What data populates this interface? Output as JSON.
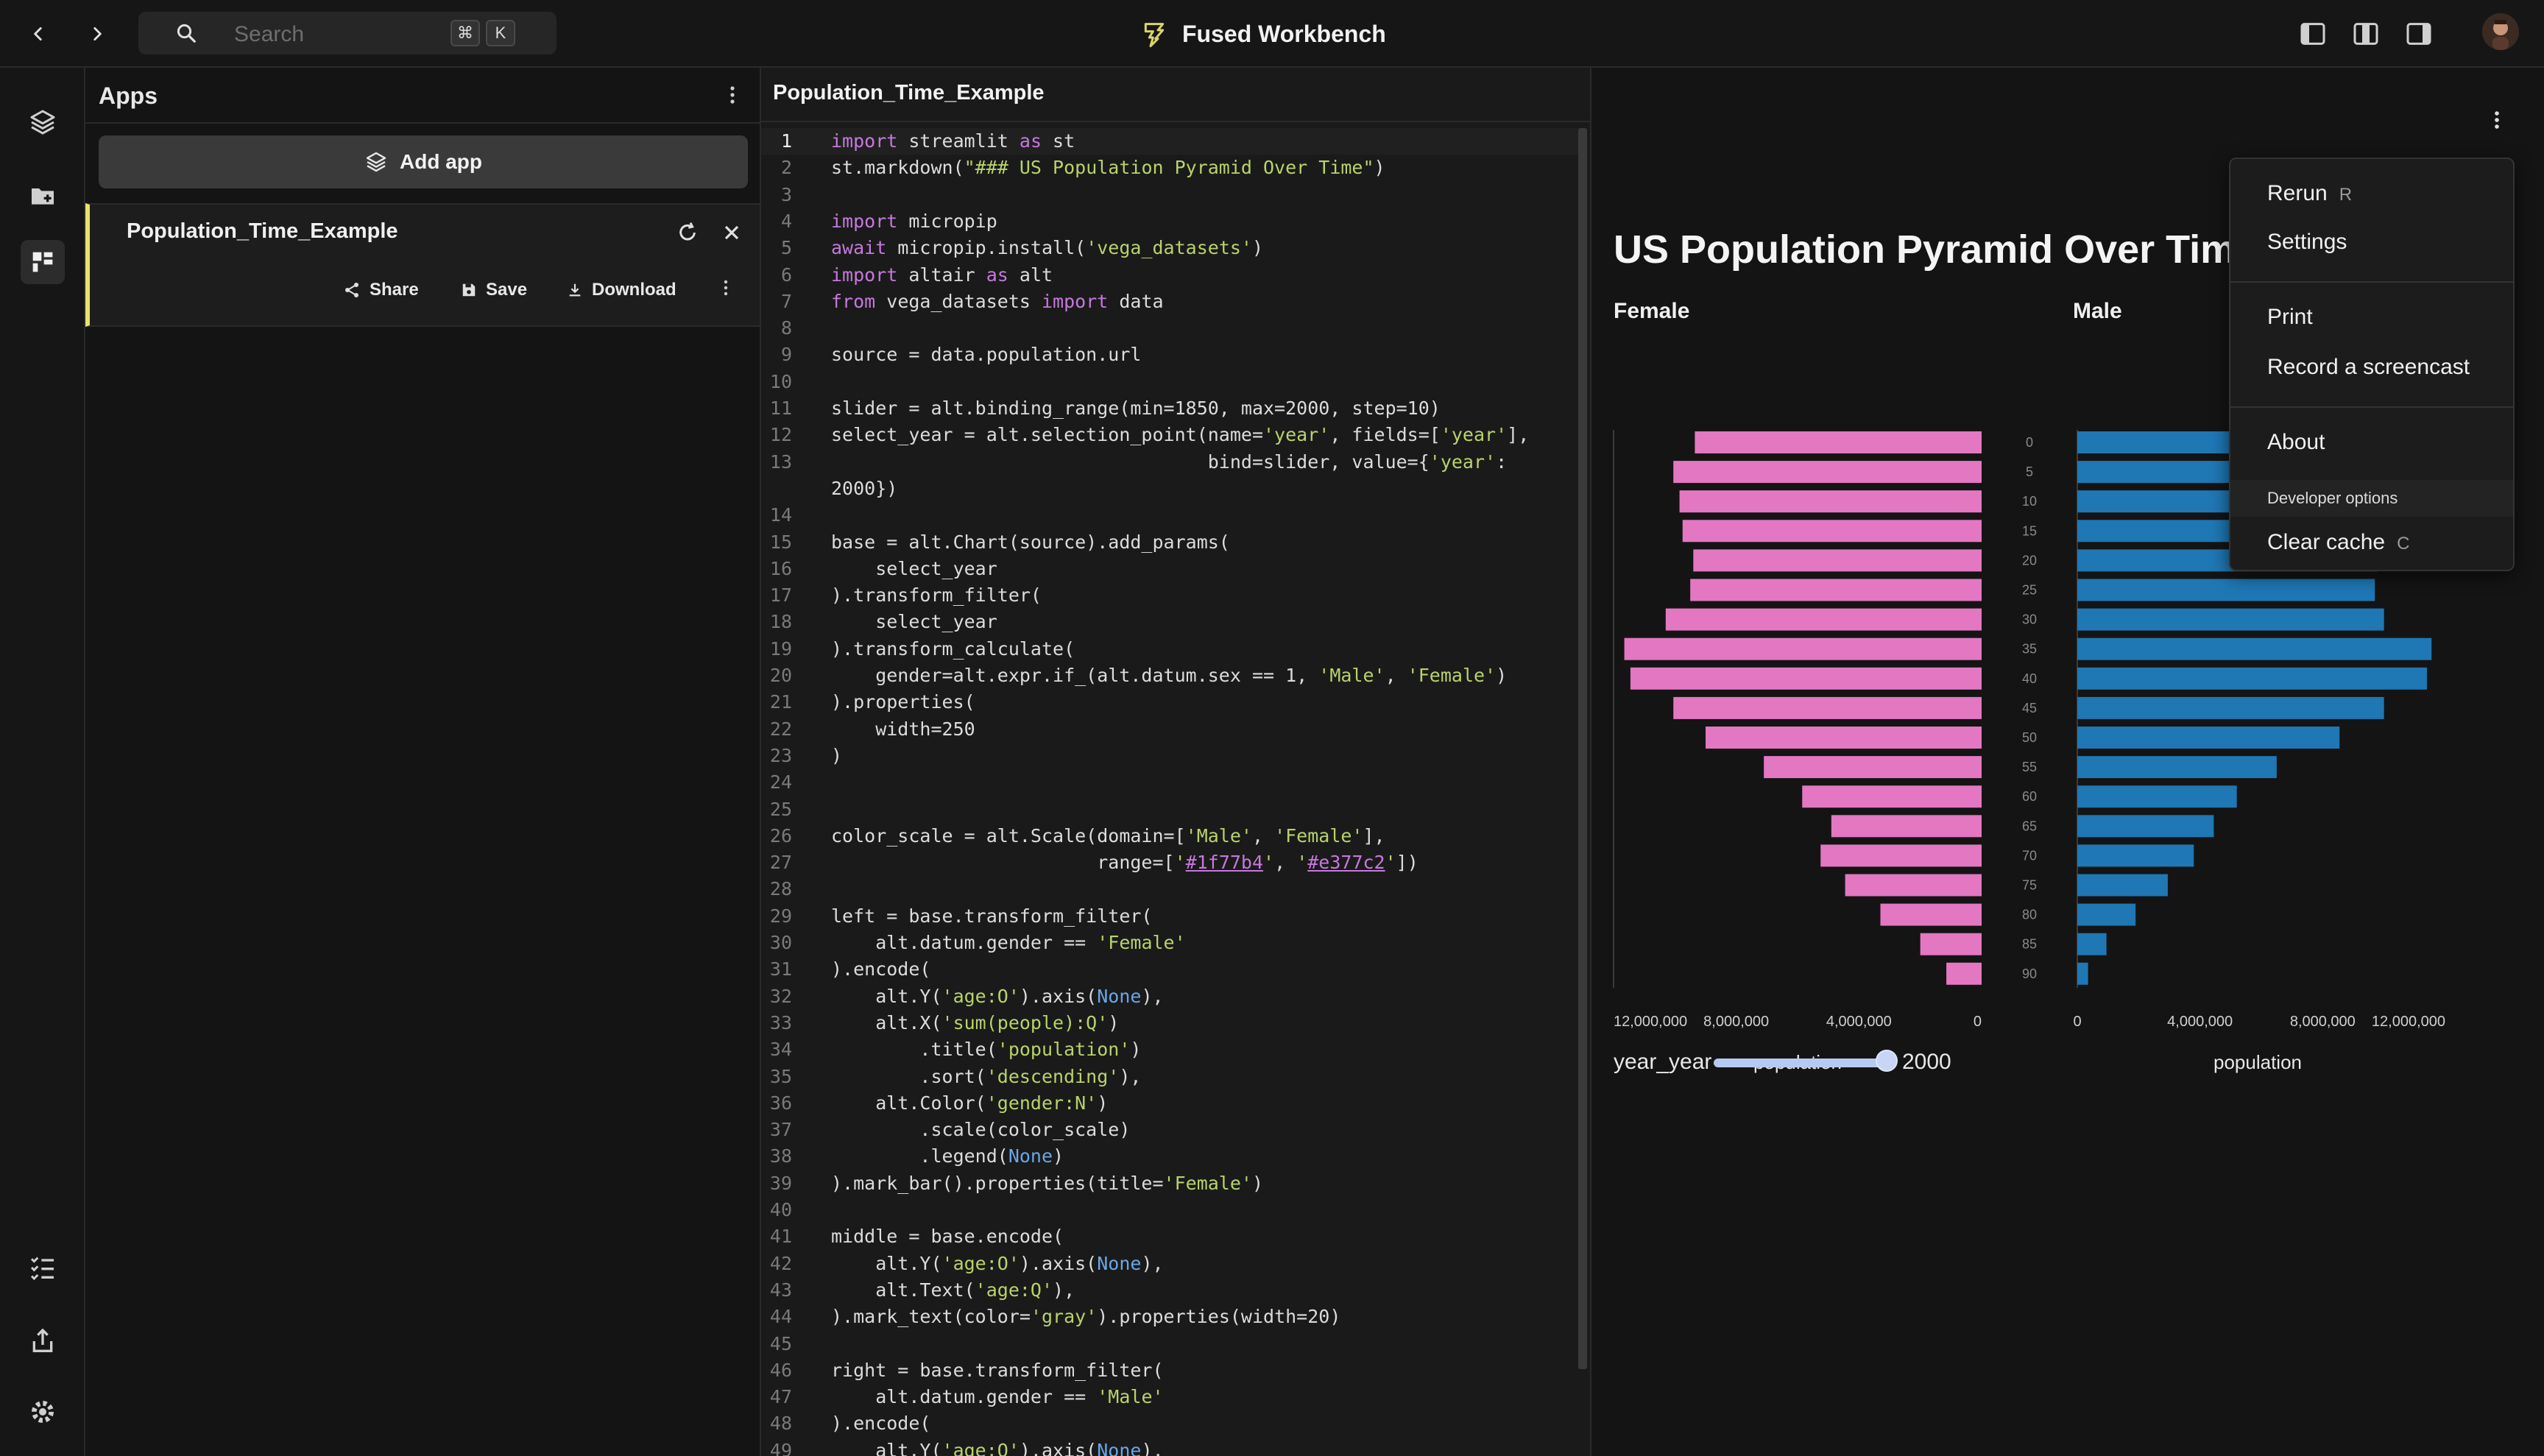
{
  "topbar": {
    "search_placeholder": "Search",
    "shortcut_keys": [
      "⌘",
      "K"
    ],
    "app_title": "Fused Workbench"
  },
  "apps_panel": {
    "title": "Apps",
    "add_app_label": "Add app",
    "item": {
      "name": "Population_Time_Example",
      "share_label": "Share",
      "save_label": "Save",
      "download_label": "Download"
    }
  },
  "editor": {
    "file_title": "Population_Time_Example",
    "active_line": 1,
    "lines": [
      "import streamlit as st",
      "st.markdown(\"### US Population Pyramid Over Time\")",
      "",
      "import micropip",
      "await micropip.install('vega_datasets')",
      "import altair as alt",
      "from vega_datasets import data",
      "",
      "source = data.population.url",
      "",
      "slider = alt.binding_range(min=1850, max=2000, step=10)",
      "select_year = alt.selection_point(name='year', fields=['year'],",
      "                                  bind=slider, value={'year':",
      "2000})",
      "",
      "base = alt.Chart(source).add_params(",
      "    select_year",
      ").transform_filter(",
      "    select_year",
      ").transform_calculate(",
      "    gender=alt.expr.if_(alt.datum.sex == 1, 'Male', 'Female')",
      ").properties(",
      "    width=250",
      ")",
      "",
      "",
      "color_scale = alt.Scale(domain=['Male', 'Female'],",
      "                        range=['#1f77b4', '#e377c2'])",
      "",
      "left = base.transform_filter(",
      "    alt.datum.gender == 'Female'",
      ").encode(",
      "    alt.Y('age:O').axis(None),",
      "    alt.X('sum(people):Q')",
      "        .title('population')",
      "        .sort('descending'),",
      "    alt.Color('gender:N')",
      "        .scale(color_scale)",
      "        .legend(None)",
      ").mark_bar().properties(title='Female')",
      "",
      "middle = base.encode(",
      "    alt.Y('age:O').axis(None),",
      "    alt.Text('age:Q'),",
      ").mark_text(color='gray').properties(width=20)",
      "",
      "right = base.transform_filter(",
      "    alt.datum.gender == 'Male'",
      ").encode(",
      "    alt.Y('age:O').axis(None),"
    ],
    "line_numbers": [
      "1",
      "2",
      "3",
      "4",
      "5",
      "6",
      "7",
      "8",
      "9",
      "10",
      "11",
      "12",
      "13",
      "",
      "14",
      "15",
      "16",
      "17",
      "18",
      "19",
      "20",
      "21",
      "22",
      "23",
      "24",
      "25",
      "26",
      "27",
      "28",
      "29",
      "30",
      "31",
      "32",
      "33",
      "34",
      "35",
      "36",
      "37",
      "38",
      "39",
      "40",
      "41",
      "42",
      "43",
      "44",
      "45",
      "46",
      "47",
      "48",
      "49"
    ]
  },
  "preview": {
    "title": "US Population Pyramid Over Time",
    "female_title": "Female",
    "male_title": "Male",
    "slider_label": "year_year",
    "slider_value": "2000",
    "slider_fraction": 1.0
  },
  "chart_data": [
    {
      "type": "bar",
      "title": "Female",
      "xlabel": "population",
      "x_reversed": true,
      "xlim": [
        0,
        12000000
      ],
      "x_ticks": [
        "12,000,000",
        "8,000,000",
        "4,000,000",
        "0"
      ],
      "categories": [
        "0",
        "5",
        "10",
        "15",
        "20",
        "25",
        "30",
        "35",
        "40",
        "45",
        "50",
        "55",
        "60",
        "65",
        "70",
        "75",
        "80",
        "85",
        "90"
      ],
      "values": [
        9350000,
        10050000,
        9850000,
        9750000,
        9400000,
        9500000,
        10300000,
        11650000,
        11450000,
        10050000,
        9000000,
        7100000,
        5850000,
        4900000,
        5250000,
        4450000,
        3300000,
        2000000,
        1150000
      ],
      "color": "#e377c2"
    },
    {
      "type": "bar",
      "title": "Male",
      "xlabel": "population",
      "xlim": [
        0,
        12000000
      ],
      "x_ticks": [
        "0",
        "4,000,000",
        "8,000,000",
        "12,000,000"
      ],
      "categories": [
        "0",
        "5",
        "10",
        "15",
        "20",
        "25",
        "30",
        "35",
        "40",
        "45",
        "50",
        "55",
        "60",
        "65",
        "70",
        "75",
        "80",
        "85",
        "90"
      ],
      "values": [
        9800000,
        10500000,
        10300000,
        10200000,
        9800000,
        9700000,
        10000000,
        11550000,
        11400000,
        10000000,
        8550000,
        6500000,
        5200000,
        4450000,
        3800000,
        2950000,
        1900000,
        950000,
        350000
      ],
      "color": "#1f77b4"
    }
  ],
  "dropdown_menu": {
    "rerun_label": "Rerun",
    "rerun_key": "R",
    "settings_label": "Settings",
    "print_label": "Print",
    "record_label": "Record a screencast",
    "about_label": "About",
    "developer_header": "Developer options",
    "clear_cache_label": "Clear cache",
    "clear_cache_key": "C"
  }
}
